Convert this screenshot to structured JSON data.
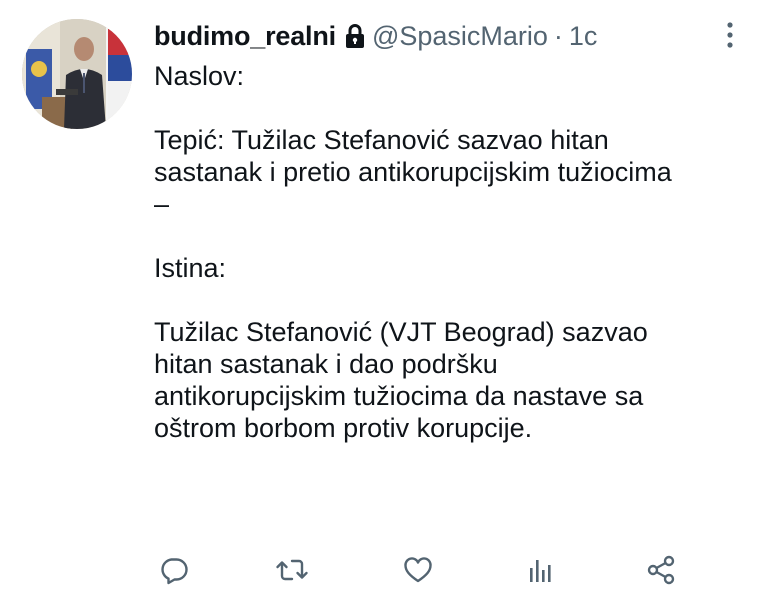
{
  "tweet": {
    "display_name": "budimo_realni",
    "handle": "@SpasicMario",
    "separator": "·",
    "timestamp": "1c",
    "protected_icon": "lock-icon",
    "more_icon": "more-vertical-icon",
    "text_lines": [
      "Naslov:",
      "",
      "Tepić: Tužilac Stefanović sazvao hitan",
      "sastanak i pretio antikorupcijskim tužiocima",
      "–",
      "",
      "Istina:",
      "",
      "Tužilac Stefanović (VJT Beograd) sazvao",
      "hitan sastanak i dao podršku",
      "antikorupcijskim tužiocima da nastave sa",
      "oštrom borbom protiv korupcije."
    ]
  },
  "actions": {
    "reply_icon": "reply-icon",
    "retweet_icon": "retweet-icon",
    "like_icon": "heart-icon",
    "views_icon": "analytics-icon",
    "share_icon": "share-icon"
  },
  "colors": {
    "text": "#0f1419",
    "secondary": "#536471",
    "icon": "#536471",
    "background": "#ffffff"
  }
}
